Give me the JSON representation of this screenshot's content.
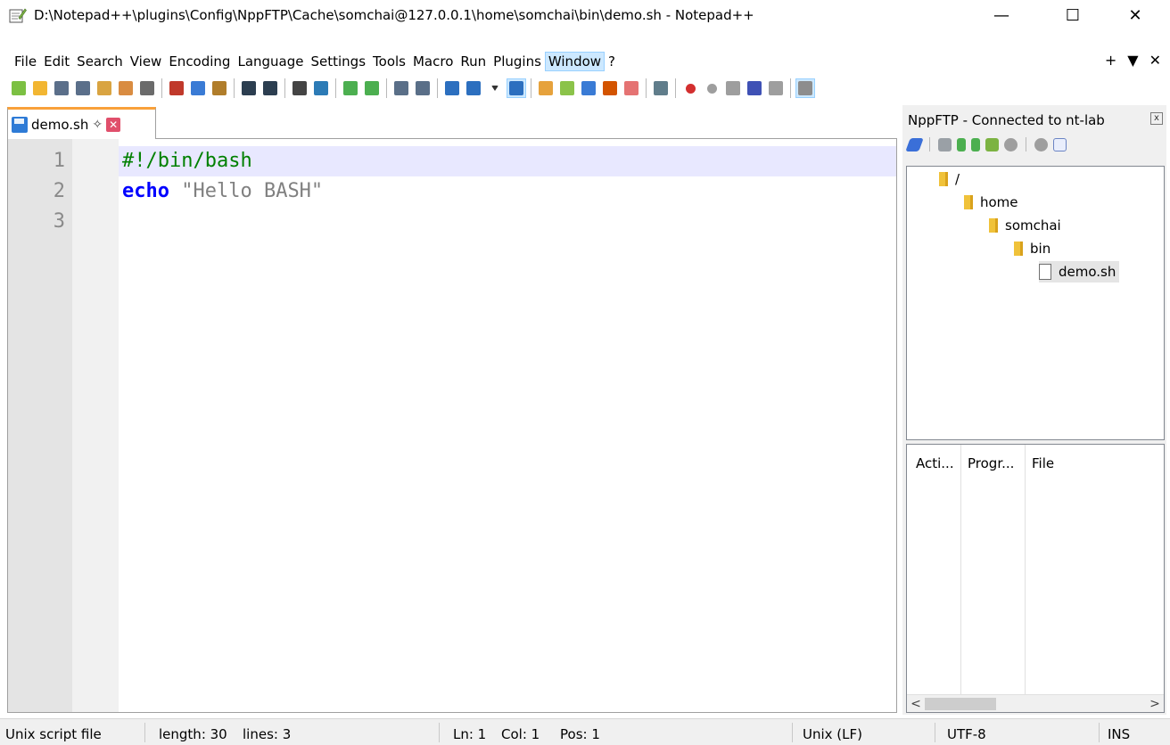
{
  "window": {
    "title": "D:\\Notepad++\\plugins\\Config\\NppFTP\\Cache\\somchai@127.0.0.1\\home\\somchai\\bin\\demo.sh - Notepad++",
    "minimize": "—",
    "maximize": "☐",
    "close": "✕"
  },
  "menu": {
    "items": [
      "File",
      "Edit",
      "Search",
      "View",
      "Encoding",
      "Language",
      "Settings",
      "Tools",
      "Macro",
      "Run",
      "Plugins",
      "Window",
      "?"
    ],
    "active": "Window",
    "right": [
      "+",
      "▼",
      "✕"
    ]
  },
  "toolbar": {
    "icons": [
      "new-icon",
      "open-icon",
      "save-icon",
      "save-all-icon",
      "close-icon",
      "close-all-icon",
      "print-icon",
      "|",
      "cut-icon",
      "copy-icon",
      "paste-icon",
      "|",
      "undo-icon",
      "redo-icon",
      "|",
      "find-icon",
      "replace-icon",
      "|",
      "zoom-in-icon",
      "zoom-out-icon",
      "|",
      "sync-vertical-icon",
      "sync-horizontal-icon",
      "|",
      "word-wrap-icon",
      "show-all-chars-icon",
      "dropdown-icon",
      "indent-guide-icon",
      "|",
      "udl-icon",
      "doc-map-icon",
      "doc-list-icon",
      "function-list-icon",
      "folder-as-workspace-icon",
      "|",
      "monitoring-icon",
      "|",
      "record-macro-icon",
      "stop-record-icon",
      "play-macro-icon",
      "run-multiple-icon",
      "save-macro-icon",
      "|",
      "nppftp-icon"
    ]
  },
  "tab": {
    "label": "demo.sh",
    "pin": "✧",
    "close": "✕"
  },
  "editor": {
    "lines": [
      {
        "num": "1",
        "tokens": [
          {
            "t": "#!/bin/bash",
            "c": "comment"
          }
        ]
      },
      {
        "num": "2",
        "tokens": [
          {
            "t": "echo",
            "c": "keyword"
          },
          {
            "t": " ",
            "c": ""
          },
          {
            "t": "\"Hello BASH\"",
            "c": "string"
          }
        ]
      },
      {
        "num": "3",
        "tokens": []
      }
    ],
    "current_line": 1
  },
  "nppftp": {
    "title": "NppFTP - Connected to nt-lab",
    "close": "x",
    "tree": [
      {
        "label": "/",
        "type": "folder",
        "depth": 0
      },
      {
        "label": "home",
        "type": "folder",
        "depth": 1
      },
      {
        "label": "somchai",
        "type": "folder",
        "depth": 2
      },
      {
        "label": "bin",
        "type": "folder",
        "depth": 3
      },
      {
        "label": "demo.sh",
        "type": "file",
        "depth": 4,
        "selected": true
      }
    ],
    "queue_columns": [
      "Acti...",
      "Progr...",
      "File"
    ],
    "scroll_left": "<",
    "scroll_right": ">"
  },
  "status": {
    "filetype": "Unix script file",
    "length": "length: 30",
    "lines": "lines: 3",
    "ln": "Ln: 1",
    "col": "Col: 1",
    "pos": "Pos: 1",
    "eol": "Unix (LF)",
    "encoding": "UTF-8",
    "mode": "INS"
  },
  "colors": {
    "tab_accent": "#f9a13a",
    "comment": "#008000",
    "keyword": "#0000ff",
    "string": "#808080",
    "current_line_bg": "#e8e8ff"
  }
}
